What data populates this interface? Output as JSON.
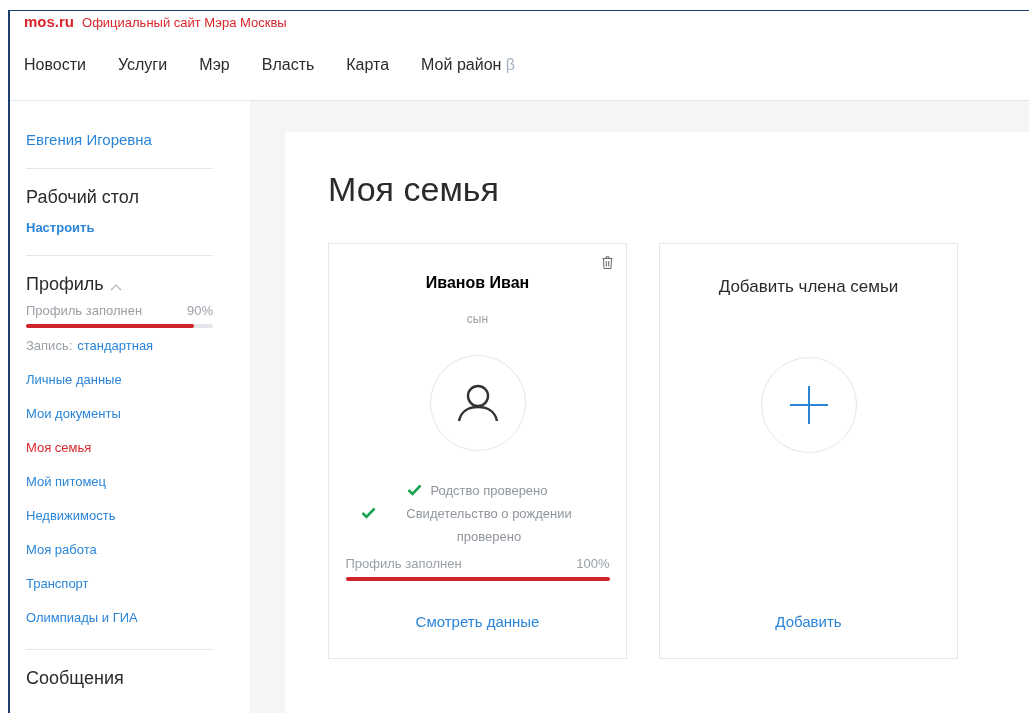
{
  "site": {
    "logo": "mos.ru",
    "tagline": "Официальный сайт Мэра Москвы"
  },
  "nav": [
    {
      "label": "Новости"
    },
    {
      "label": "Услуги"
    },
    {
      "label": "Мэр"
    },
    {
      "label": "Власть"
    },
    {
      "label": "Карта"
    },
    {
      "label": "Мой район",
      "badge": "β"
    }
  ],
  "sidebar": {
    "user": "Евгения Игоревна",
    "desktop": {
      "title": "Рабочий стол",
      "link": "Настроить"
    },
    "profile": {
      "title": "Профиль",
      "expanded": true,
      "progress": {
        "label": "Профиль заполнен",
        "reading": "90%",
        "level": 0.9
      },
      "record_label": "Запись:",
      "record_value": "стандартная",
      "items": [
        {
          "label": "Личные данные",
          "selected": false
        },
        {
          "label": "Мои документы",
          "selected": false
        },
        {
          "label": "Моя семья",
          "selected": true
        },
        {
          "label": "Мой питомец",
          "selected": false
        },
        {
          "label": "Недвижимость",
          "selected": false
        },
        {
          "label": "Моя работа",
          "selected": false
        },
        {
          "label": "Транспорт",
          "selected": false
        },
        {
          "label": "Олимпиады и ГИА",
          "selected": false
        }
      ]
    },
    "messages": {
      "title": "Сообщения"
    }
  },
  "page": {
    "title": "Моя семья",
    "members": [
      {
        "name": "Иванов Иван",
        "relation": "сын",
        "checks": [
          {
            "text": "Родство проверено",
            "checked": true
          },
          {
            "text": "Свидетельство о рождении проверено",
            "checked": true
          }
        ],
        "progress": {
          "label": "Профиль заполнен",
          "reading": "100%",
          "level": 1
        },
        "action": "Смотреть данные"
      }
    ],
    "add_card": {
      "title": "Добавить члена семьи",
      "action": "Добавить"
    }
  }
}
